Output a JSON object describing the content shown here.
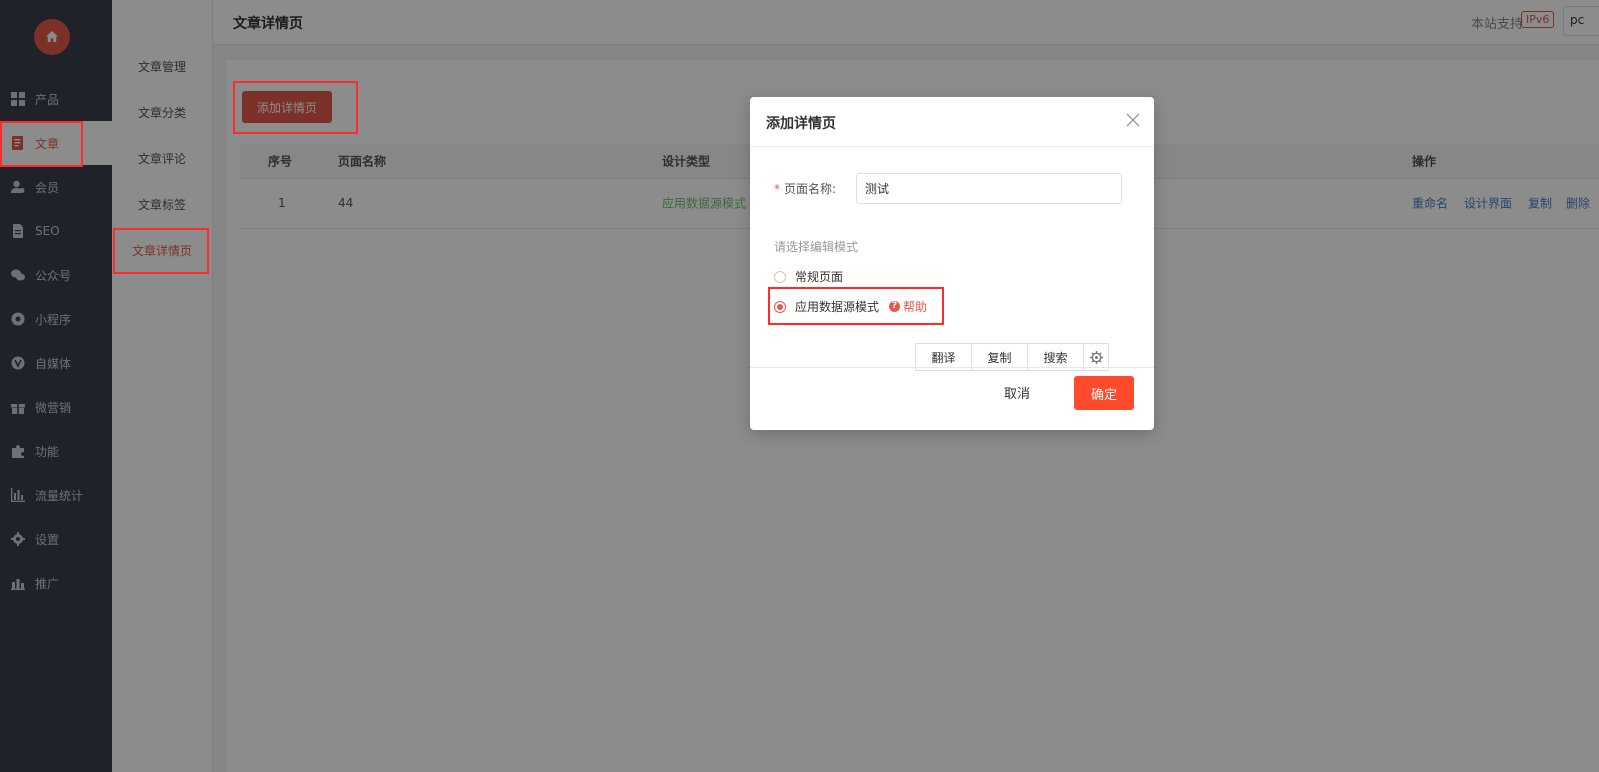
{
  "sidebar": {
    "items": [
      {
        "label": "产品",
        "icon": "grid-icon"
      },
      {
        "label": "文章",
        "icon": "document-icon"
      },
      {
        "label": "会员",
        "icon": "user-icon"
      },
      {
        "label": "SEO",
        "icon": "file-icon"
      },
      {
        "label": "公众号",
        "icon": "wechat-icon"
      },
      {
        "label": "小程序",
        "icon": "miniprogram-icon"
      },
      {
        "label": "自媒体",
        "icon": "media-icon"
      },
      {
        "label": "微营销",
        "icon": "gift-icon"
      },
      {
        "label": "功能",
        "icon": "puzzle-icon"
      },
      {
        "label": "流量统计",
        "icon": "bar-chart-icon"
      },
      {
        "label": "设置",
        "icon": "gear-icon"
      },
      {
        "label": "推广",
        "icon": "promote-icon"
      }
    ],
    "active_index": 1
  },
  "submenu": {
    "items": [
      "文章管理",
      "文章分类",
      "文章评论",
      "文章标签",
      "文章详情页"
    ],
    "active_index": 4
  },
  "header": {
    "title": "文章详情页",
    "support_text": "本站支持",
    "ipv6": "IPv6",
    "cut_text": "pc"
  },
  "main": {
    "add_button": "添加详情页",
    "table": {
      "headers": [
        "序号",
        "页面名称",
        "设计类型",
        "操作"
      ],
      "rows": [
        {
          "index": "1",
          "name": "44",
          "type": "应用数据源模式",
          "actions": [
            "重命名",
            "设计界面",
            "复制",
            "删除"
          ]
        }
      ]
    }
  },
  "dialog": {
    "title": "添加详情页",
    "name_label": "页面名称:",
    "name_required": "*",
    "name_value": "测试",
    "mode_label": "请选择编辑模式",
    "options": [
      "常规页面",
      "应用数据源模式"
    ],
    "selected_option": 1,
    "help_label": "帮助",
    "toolbar": [
      "翻译",
      "复制",
      "搜索"
    ],
    "cancel_label": "取消",
    "ok_label": "确定"
  },
  "colors": {
    "accent": "#e25a4a",
    "confirm": "#ff4a2c",
    "sidebar_bg": "#3a3f4a",
    "highlight": "#ff2a2a"
  }
}
